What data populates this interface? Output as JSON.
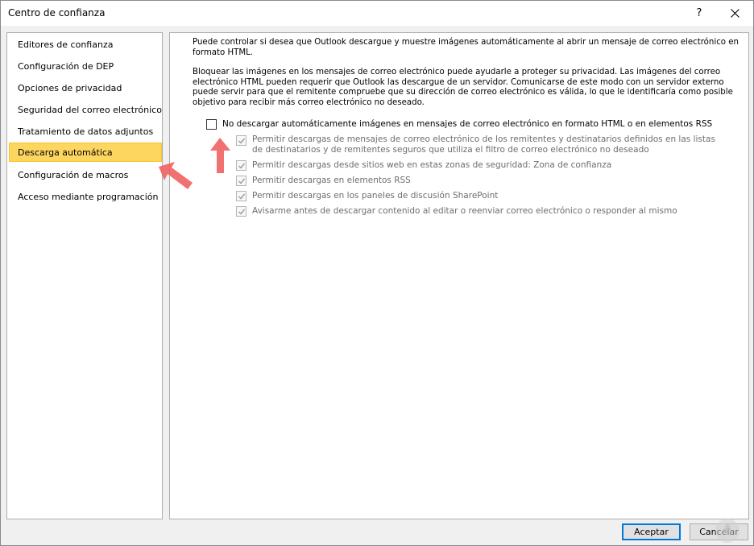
{
  "window": {
    "title": "Centro de confianza",
    "help_label": "?"
  },
  "sidebar": {
    "items": [
      {
        "label": "Editores de confianza"
      },
      {
        "label": "Configuración de DEP"
      },
      {
        "label": "Opciones de privacidad"
      },
      {
        "label": "Seguridad del correo electrónico"
      },
      {
        "label": "Tratamiento de datos adjuntos"
      },
      {
        "label": "Descarga automática",
        "selected": true
      },
      {
        "label": "Configuración de macros"
      },
      {
        "label": "Acceso mediante programación"
      }
    ],
    "selected_color": "#fcd65f"
  },
  "content": {
    "intro": "Puede controlar si desea que Outlook descargue y muestre imágenes automáticamente al abrir un mensaje de correo electrónico en formato HTML.",
    "privacy_note": "Bloquear las imágenes en los mensajes de correo electrónico puede ayudarle a proteger su privacidad. Las imágenes del correo electrónico HTML pueden requerir que Outlook las descargue de un servidor. Comunicarse de este modo con un servidor externo puede servir para que el remitente compruebe que su dirección de correo electrónico es válida, lo que le identificaría como posible objetivo para recibir más correo electrónico no deseado.",
    "main_option": {
      "label": "No descargar automáticamente imágenes en mensajes de correo electrónico en formato HTML o en elementos RSS",
      "checked": false
    },
    "sub_options": [
      {
        "label": "Permitir descargas de mensajes de correo electrónico de los remitentes y destinatarios definidos en las listas de destinatarios y de remitentes seguros que utiliza el filtro de correo electrónico no deseado",
        "checked": true,
        "enabled": false
      },
      {
        "label": "Permitir descargas desde sitios web en estas zonas de seguridad: Zona de confianza",
        "checked": true,
        "enabled": false
      },
      {
        "label": "Permitir descargas en elementos RSS",
        "checked": true,
        "enabled": false
      },
      {
        "label": "Permitir descargas en los paneles de discusión SharePoint",
        "checked": true,
        "enabled": false
      },
      {
        "label": "Avisarme antes de descargar contenido al editar o reenviar correo electrónico o responder al mismo",
        "checked": true,
        "enabled": false
      }
    ]
  },
  "footer": {
    "accept_label": "Aceptar",
    "cancel_label": "Cancelar"
  },
  "annotation_color": "#f06060"
}
